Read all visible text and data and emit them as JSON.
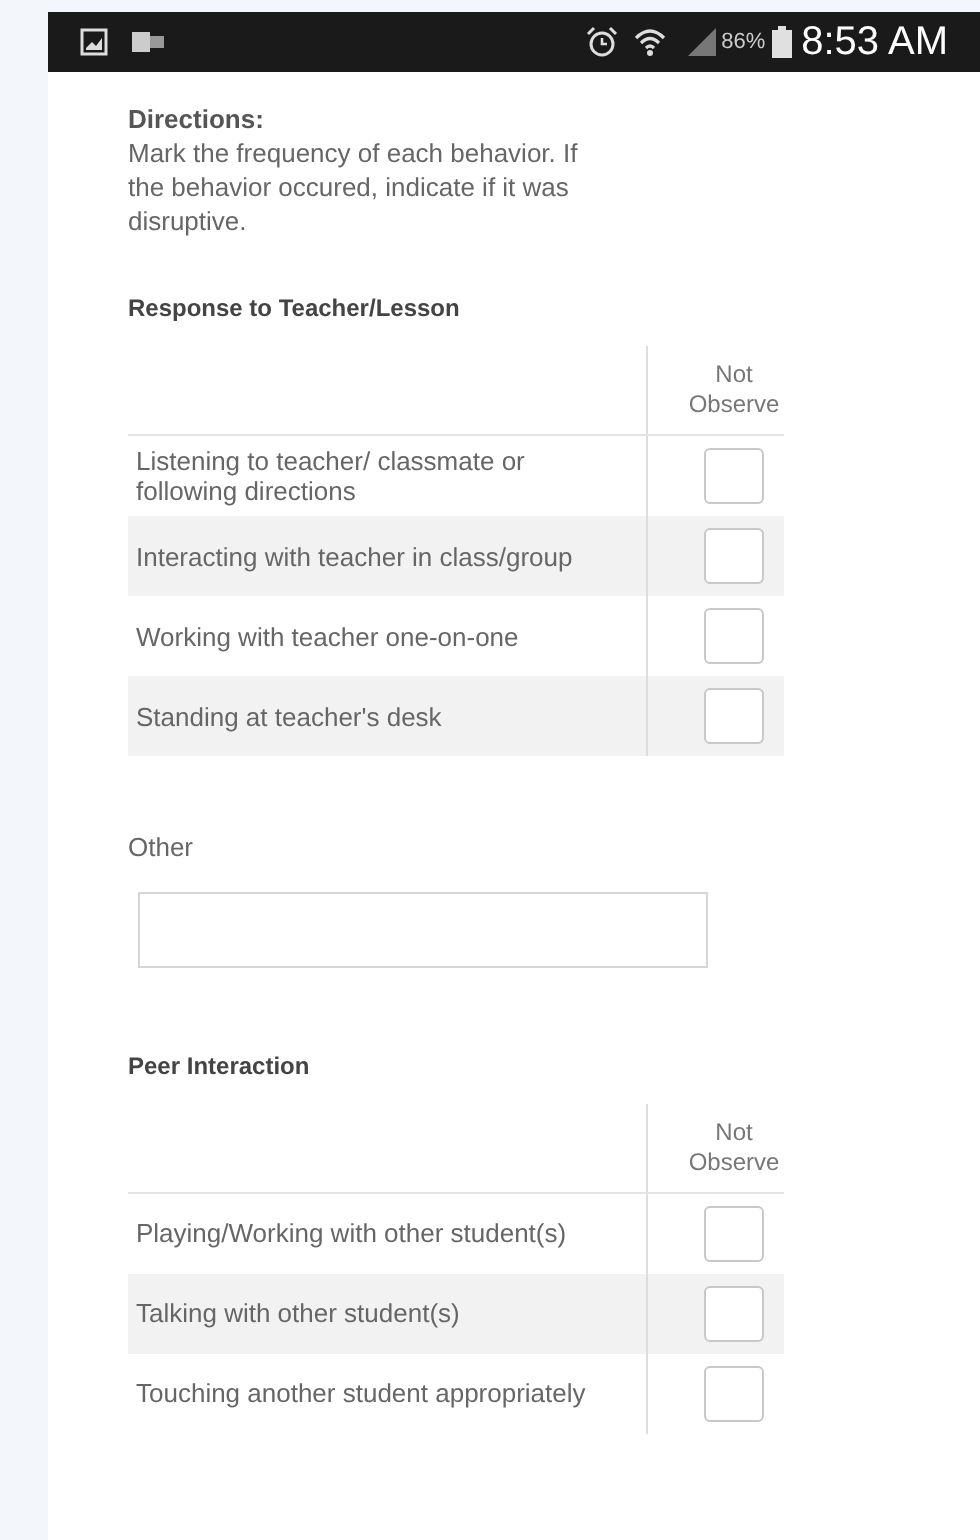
{
  "status_bar": {
    "battery": "86%",
    "time": "8:53 AM"
  },
  "directions": {
    "title": "Directions:",
    "text": "Mark the frequency of each behavior. If the behavior occured, indicate if it was disruptive."
  },
  "sections": [
    {
      "kind": "checklist",
      "title": "Response to Teacher/Lesson",
      "column_header": "Not Observe",
      "rows": [
        {
          "label": "Listening to teacher/ classmate or following directions",
          "checked": false
        },
        {
          "label": "Interacting with teacher in class/group",
          "checked": false
        },
        {
          "label": "Working with teacher one-on-one",
          "checked": false
        },
        {
          "label": "Standing at teacher's desk",
          "checked": false
        }
      ]
    },
    {
      "kind": "text_field",
      "label": "Other"
    },
    {
      "kind": "checklist",
      "title": "Peer Interaction",
      "column_header": "Not Observe",
      "rows": [
        {
          "label": "Playing/Working with other student(s)",
          "checked": false
        },
        {
          "label": "Talking with other student(s)",
          "checked": false
        },
        {
          "label": "Touching another student appropriately",
          "checked": false
        }
      ]
    }
  ]
}
